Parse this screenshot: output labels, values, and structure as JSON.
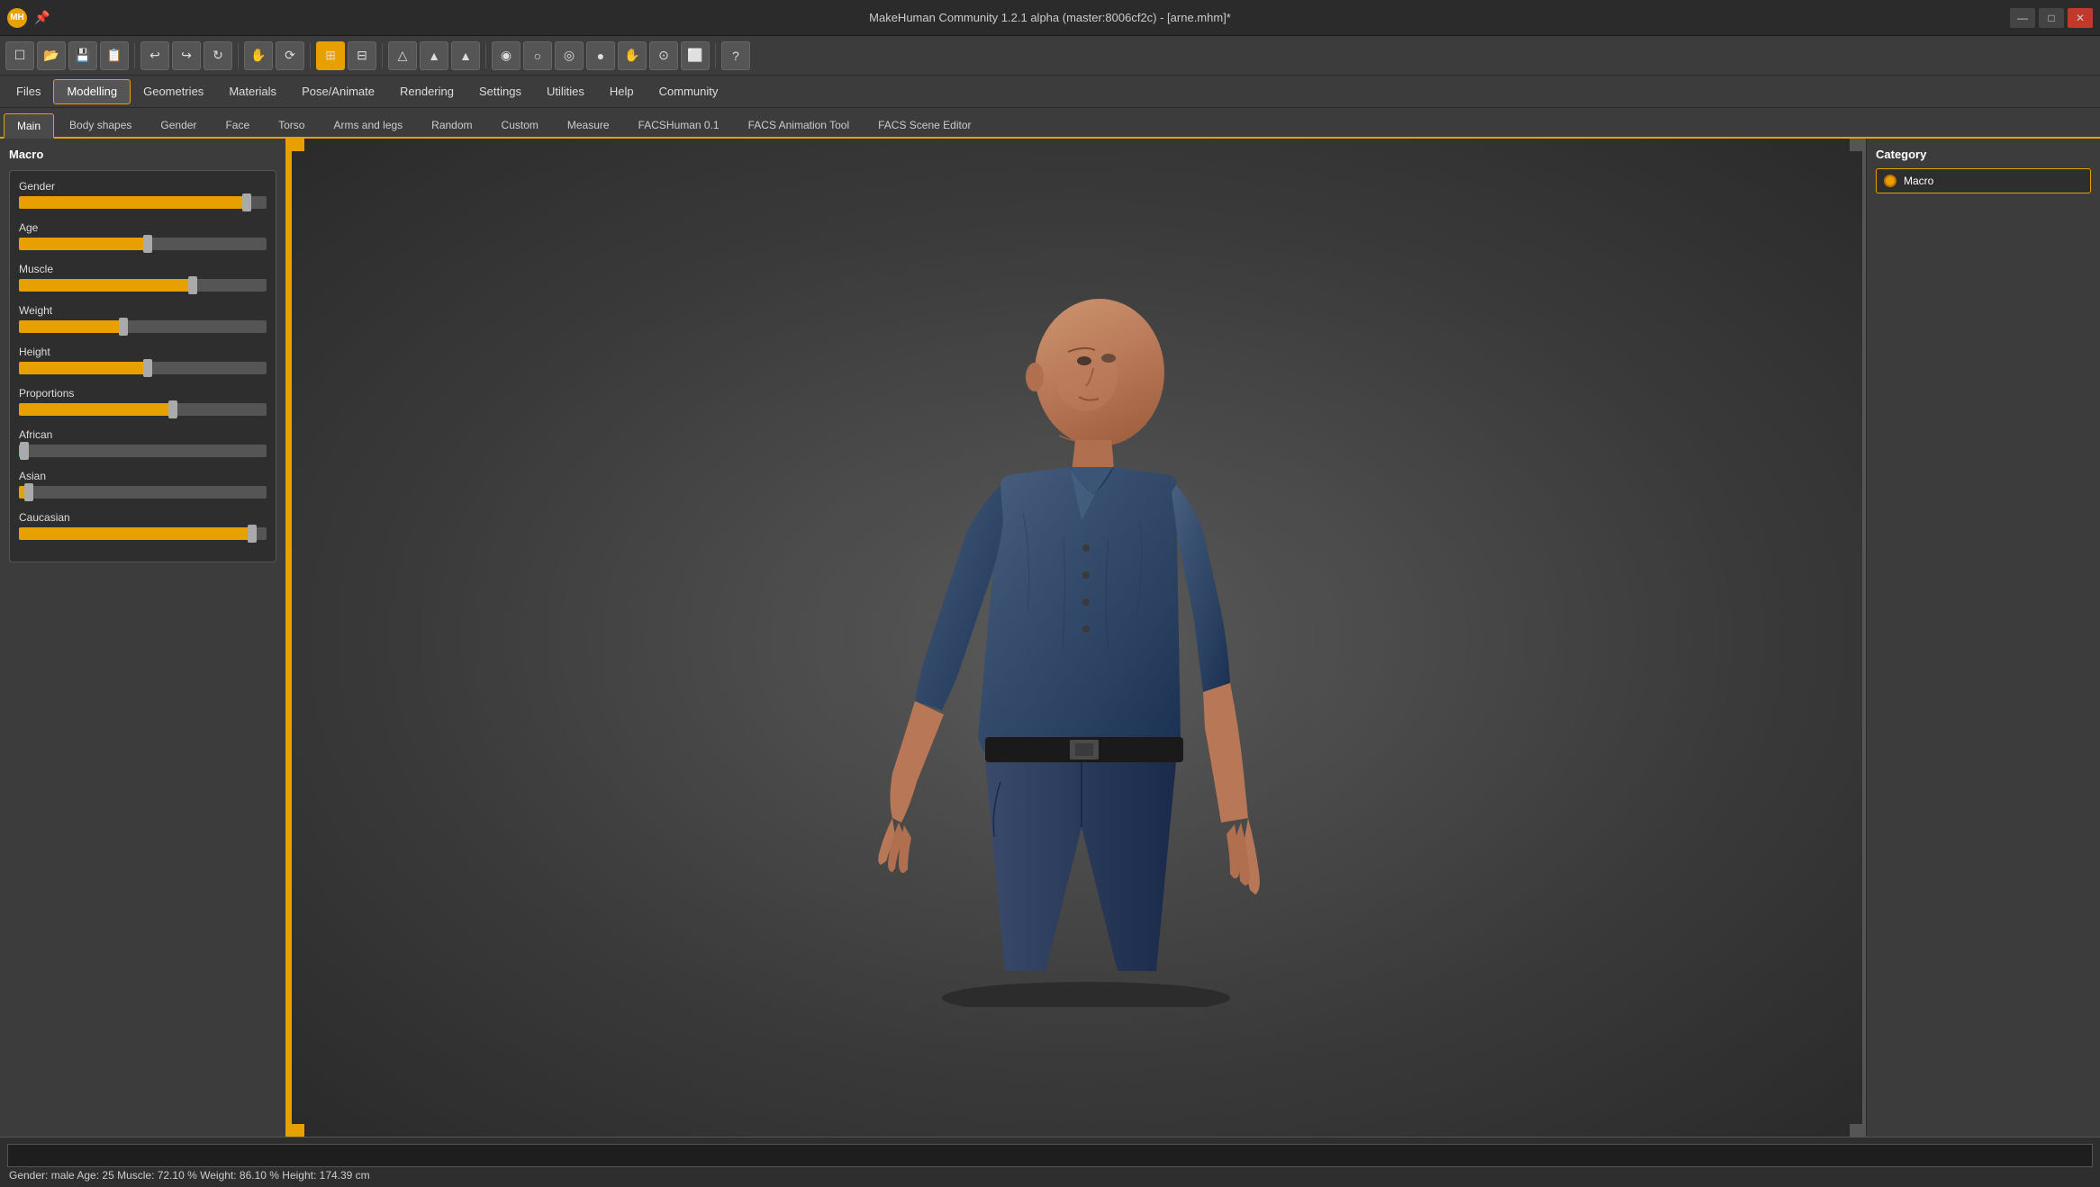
{
  "titlebar": {
    "title": "MakeHuman Community 1.2.1 alpha (master:8006cf2c) - [arne.mhm]*",
    "icon": "MH"
  },
  "toolbar": {
    "buttons": [
      {
        "name": "new",
        "icon": "☐"
      },
      {
        "name": "open",
        "icon": "📂"
      },
      {
        "name": "save",
        "icon": "💾"
      },
      {
        "name": "save-as",
        "icon": "📋"
      },
      {
        "name": "undo",
        "icon": "↩"
      },
      {
        "name": "redo",
        "icon": "↪"
      },
      {
        "name": "refresh",
        "icon": "↻"
      },
      {
        "name": "grab",
        "icon": "✋"
      },
      {
        "name": "rotate",
        "icon": "⟳"
      },
      {
        "name": "grid1",
        "icon": "⊞"
      },
      {
        "name": "grid2",
        "icon": "⊟"
      },
      {
        "name": "sym1",
        "icon": "△"
      },
      {
        "name": "sym2",
        "icon": "▲"
      },
      {
        "name": "sym3",
        "icon": "▲"
      },
      {
        "name": "head",
        "icon": "◉"
      },
      {
        "name": "body",
        "icon": "○"
      },
      {
        "name": "globe",
        "icon": "◎"
      },
      {
        "name": "sphere",
        "icon": "●"
      },
      {
        "name": "hands",
        "icon": "✋"
      },
      {
        "name": "ring",
        "icon": "⊙"
      },
      {
        "name": "box",
        "icon": "⬜"
      },
      {
        "name": "question",
        "icon": "?"
      }
    ]
  },
  "menubar": {
    "items": [
      "Files",
      "Modelling",
      "Geometries",
      "Materials",
      "Pose/Animate",
      "Rendering",
      "Settings",
      "Utilities",
      "Help",
      "Community"
    ],
    "active": "Modelling"
  },
  "tabs": {
    "items": [
      "Main",
      "Body shapes",
      "Gender",
      "Face",
      "Torso",
      "Arms and legs",
      "Random",
      "Custom",
      "Measure",
      "FACSHuman 0.1",
      "FACS Animation Tool",
      "FACS Scene Editor"
    ],
    "active": "Main"
  },
  "leftpanel": {
    "title": "Macro",
    "sliders": [
      {
        "label": "Gender",
        "fill": 92,
        "handle": 91
      },
      {
        "label": "Age",
        "fill": 52,
        "handle": 51
      },
      {
        "label": "Muscle",
        "fill": 70,
        "handle": 69
      },
      {
        "label": "Weight",
        "fill": 42,
        "handle": 41
      },
      {
        "label": "Height",
        "fill": 52,
        "handle": 51
      },
      {
        "label": "Proportions",
        "fill": 62,
        "handle": 61
      },
      {
        "label": "African",
        "fill": 2,
        "handle": 1
      },
      {
        "label": "Asian",
        "fill": 4,
        "handle": 3
      },
      {
        "label": "Caucasian",
        "fill": 94,
        "handle": 93
      }
    ]
  },
  "rightpanel": {
    "category_title": "Category",
    "items": [
      {
        "label": "Macro",
        "active": true
      }
    ]
  },
  "statusbar": {
    "text": "Gender: male  Age: 25  Muscle: 72.10 %  Weight: 86.10 %  Height: 174.39 cm",
    "input_placeholder": ""
  }
}
